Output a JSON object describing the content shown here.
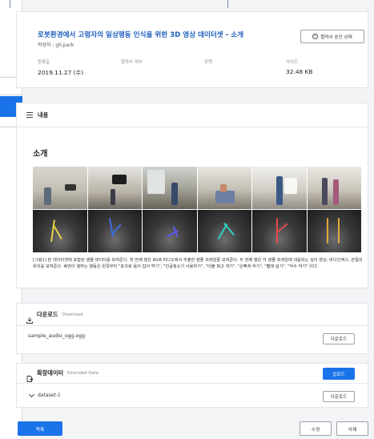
{
  "header": {
    "title": "로봇환경에서 고령자의 일상행동 인식을 위한 3D 영상 데이터셋 - 소개",
    "author": "작성자 : gh.park",
    "contract_button": "협약서 승인 상태",
    "meta": [
      {
        "label": "등록일",
        "value": "2019.11.27 (수)"
      },
      {
        "label": "협약서 여부",
        "value": ""
      },
      {
        "label": "포맷",
        "value": ""
      },
      {
        "label": "사이즈",
        "value": "32.48 KB"
      }
    ]
  },
  "content": {
    "section_title": "내용",
    "intro_title": "소개",
    "caption": "[그림1] 본 데이터셋에 포함된 샘플 데이터를 보여준다. 첫 번째 행은 RGB 비디오에서 추출한 샘플 프레임을 보여준다. 두 번째 행은 각 샘플 프레임에 대응되는 깊이 영상, 바디인덱스, 관절의 위치를 보여준다. 휴먼이 행하는 행동은 왼쪽부터 \"포크로 음식 집어 먹기\", \"진공청소기 사용하기\", \"이불 펴고 개기\", \"손뼉쳐 하기\", \"빨래 널기\", \"악수 하기\" 이다."
  },
  "download": {
    "title": "다운로드",
    "subtitle": "Download",
    "file_name": "sample_audio_ogg.ogg",
    "button": "다운로드"
  },
  "extended": {
    "title": "확장데이터",
    "subtitle": "Extended Data",
    "upload_button": "업로드",
    "dataset_name": "dataset-1",
    "download_button": "다운로드"
  },
  "footer": {
    "list_button": "목록",
    "edit_button": "수정",
    "delete_button": "삭제"
  },
  "colors": {
    "accent": "#1a73e8",
    "title": "#1f5fbf"
  }
}
